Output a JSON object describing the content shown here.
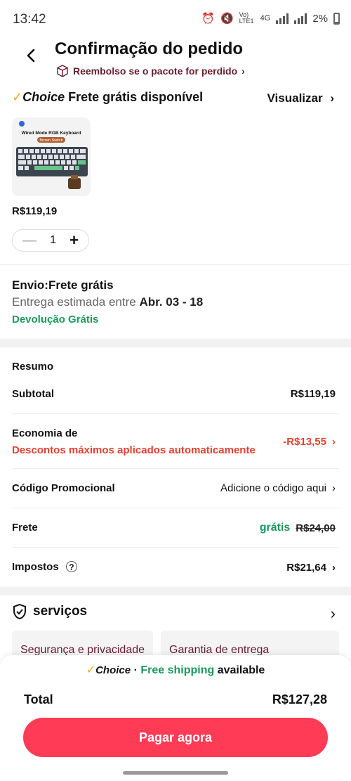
{
  "status": {
    "time": "13:42",
    "network": "Vo) LTE1",
    "gen": "4G",
    "battery": "2%"
  },
  "header": {
    "title": "Confirmação do pedido",
    "refund": "Reembolso se o pacote for perdido"
  },
  "choice": {
    "logo": "Choice",
    "label": "Frete grátis disponível",
    "view": "Visualizar"
  },
  "product": {
    "brand": "Wired Mode RGB Keyboard",
    "tag": "Brown Switch",
    "price": "R$119,19",
    "quantity": "1"
  },
  "shipping": {
    "title": "Envio:Frete grátis",
    "estimate_prefix": "Entrega estimada entre",
    "estimate_dates": "Abr. 03 - 18",
    "returns": "Devolução Grátis"
  },
  "summary": {
    "heading": "Resumo",
    "subtotal_label": "Subtotal",
    "subtotal_value": "R$119,19",
    "savings_label": "Economia de",
    "savings_note": "Descontos máximos aplicados automaticamente",
    "savings_value": "-R$13,55",
    "promo_label": "Código Promocional",
    "promo_value": "Adicione o código aqui",
    "shipping_label": "Frete",
    "shipping_free": "grátis",
    "shipping_old": "R$24,00",
    "taxes_label": "Impostos",
    "taxes_value": "R$21,64"
  },
  "services": {
    "title": "serviços",
    "cards": [
      "Segurança e privacidade",
      "Garantia de entrega"
    ]
  },
  "footer": {
    "choice": "Choice",
    "dot": "·",
    "free_shipping": "Free shipping",
    "available": "available",
    "total_label": "Total",
    "total_value": "R$127,28",
    "pay": "Pagar agora"
  },
  "colors": {
    "accent": "#ff3b55",
    "green": "#1a9a5b",
    "red": "#e5402f",
    "maroon": "#6a1b2f"
  }
}
